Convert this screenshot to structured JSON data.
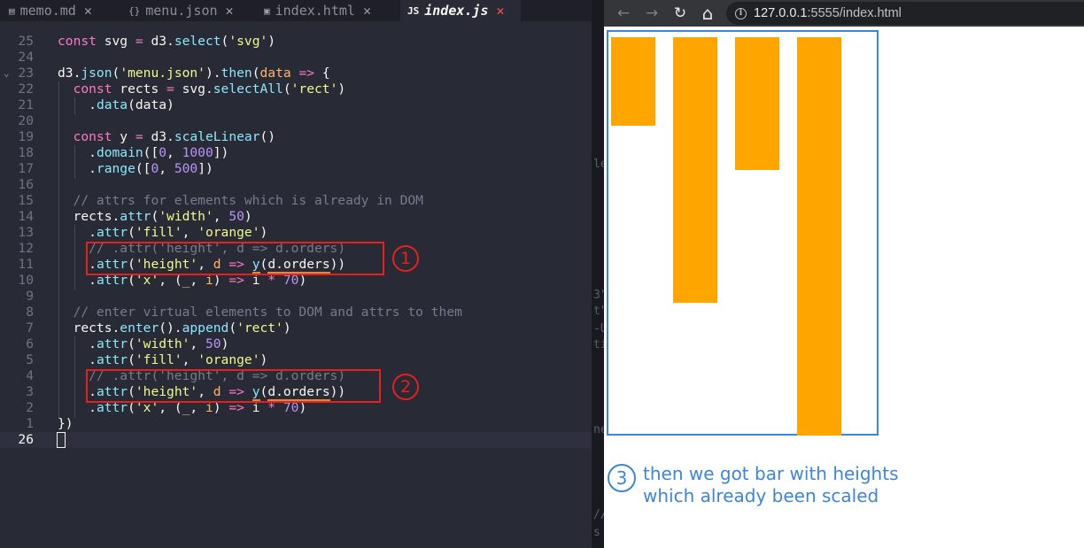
{
  "editor": {
    "tabs": [
      {
        "icon": "▤",
        "label": "memo.md",
        "close": "✕",
        "active": false
      },
      {
        "icon": "{}",
        "label": "menu.json",
        "close": "✕",
        "active": false
      },
      {
        "icon": "▣",
        "label": "index.html",
        "close": "✕",
        "active": false
      },
      {
        "icon": "JS",
        "label": "index.js",
        "close": "✕",
        "active": true
      }
    ],
    "lines": [
      {
        "num": "25",
        "html": "<span class=\"k\">const</span> svg <span class=\"k\">=</span> d3.<span class=\"f\">select</span>(<span class=\"s\">'svg'</span>)"
      },
      {
        "num": "24",
        "html": ""
      },
      {
        "num": "23",
        "html": "d3.<span class=\"f\">json</span>(<span class=\"s\">'menu.json'</span>).<span class=\"f\">then</span>(<span class=\"p\">data</span> <span class=\"k\">=&gt;</span> {"
      },
      {
        "num": "22",
        "html": "  <span class=\"k\">const</span> rects <span class=\"k\">=</span> svg.<span class=\"f\">selectAll</span>(<span class=\"s\">'rect'</span>)"
      },
      {
        "num": "21",
        "html": "    .<span class=\"f\">data</span>(data)"
      },
      {
        "num": "20",
        "html": ""
      },
      {
        "num": "19",
        "html": "  <span class=\"k\">const</span> y <span class=\"k\">=</span> d3.<span class=\"f\">scaleLinear</span>()"
      },
      {
        "num": "18",
        "html": "    .<span class=\"f\">domain</span>([<span class=\"n\">0</span>, <span class=\"n\">1000</span>])"
      },
      {
        "num": "17",
        "html": "    .<span class=\"f\">range</span>([<span class=\"n\">0</span>, <span class=\"n\">500</span>])"
      },
      {
        "num": "16",
        "html": ""
      },
      {
        "num": "15",
        "html": "  <span class=\"c\">// attrs for elements which is already in DOM</span>"
      },
      {
        "num": "14",
        "html": "  rects.<span class=\"f\">attr</span>(<span class=\"s\">'width'</span>, <span class=\"n\">50</span>)"
      },
      {
        "num": "13",
        "html": "    .<span class=\"f\">attr</span>(<span class=\"s\">'fill'</span>, <span class=\"s\">'orange'</span>)"
      },
      {
        "num": "12",
        "html": "    <span class=\"c\">// .attr('height', d =&gt; d.orders)</span>"
      },
      {
        "num": "11",
        "html": "    .<span class=\"f\">attr</span>(<span class=\"s\">'height'</span>, <span class=\"p\">d</span> <span class=\"k\">=&gt;</span> <span class=\"f u\">y</span>(<span class=\"u\">d.orders</span>))"
      },
      {
        "num": "10",
        "html": "    .<span class=\"f\">attr</span>(<span class=\"s\">'x'</span>, (<span class=\"p\">_</span>, <span class=\"p\">i</span>) <span class=\"k\">=&gt;</span> i <span class=\"k\">*</span> <span class=\"n\">70</span>)"
      },
      {
        "num": "9",
        "html": ""
      },
      {
        "num": "8",
        "html": "  <span class=\"c\">// enter virtual elements to DOM and attrs to them</span>"
      },
      {
        "num": "7",
        "html": "  rects.<span class=\"f\">enter</span>().<span class=\"f\">append</span>(<span class=\"s\">'rect'</span>)"
      },
      {
        "num": "6",
        "html": "    .<span class=\"f\">attr</span>(<span class=\"s\">'width'</span>, <span class=\"n\">50</span>)"
      },
      {
        "num": "5",
        "html": "    .<span class=\"f\">attr</span>(<span class=\"s\">'fill'</span>, <span class=\"s\">'orange'</span>)"
      },
      {
        "num": "4",
        "html": "    <span class=\"c\">// .attr('height', d =&gt; d.orders)</span>"
      },
      {
        "num": "3",
        "html": "    .<span class=\"f\">attr</span>(<span class=\"s\">'height'</span>, <span class=\"p\">d</span> <span class=\"k\">=&gt;</span> <span class=\"f u\">y</span>(<span class=\"u\">d.orders</span>))"
      },
      {
        "num": "2",
        "html": "    .<span class=\"f\">attr</span>(<span class=\"s\">'x'</span>, (<span class=\"p\">_</span>, <span class=\"p\">i</span>) <span class=\"k\">=&gt;</span> i <span class=\"k\">*</span> <span class=\"n\">70</span>)"
      },
      {
        "num": "1",
        "html": "})"
      },
      {
        "num": "26",
        "html": "",
        "current": true
      }
    ],
    "annotations": {
      "first": "1",
      "second": "2"
    }
  },
  "browser": {
    "back_icon": "←",
    "forward_icon": "→",
    "reload_icon": "↻",
    "home_icon": "⌂",
    "url_host": "127.0.0.1",
    "url_rest": ":5555/index.html",
    "caption_number": "3",
    "caption_line1": "then we got bar with heights",
    "caption_line2": "which already been scaled"
  },
  "chart_data": {
    "type": "bar",
    "values": [
      200,
      600,
      300,
      900
    ],
    "fill": "#ffa500",
    "scale": {
      "domain": [
        0,
        1000
      ],
      "range": [
        0,
        500
      ]
    },
    "bar_width": 50,
    "bar_spacing": 70,
    "orientation": "top-anchored"
  },
  "colors": {
    "annotation_red": "#e8201c",
    "annotation_blue": "#3d86d6",
    "bar_orange": "#ffa500"
  }
}
